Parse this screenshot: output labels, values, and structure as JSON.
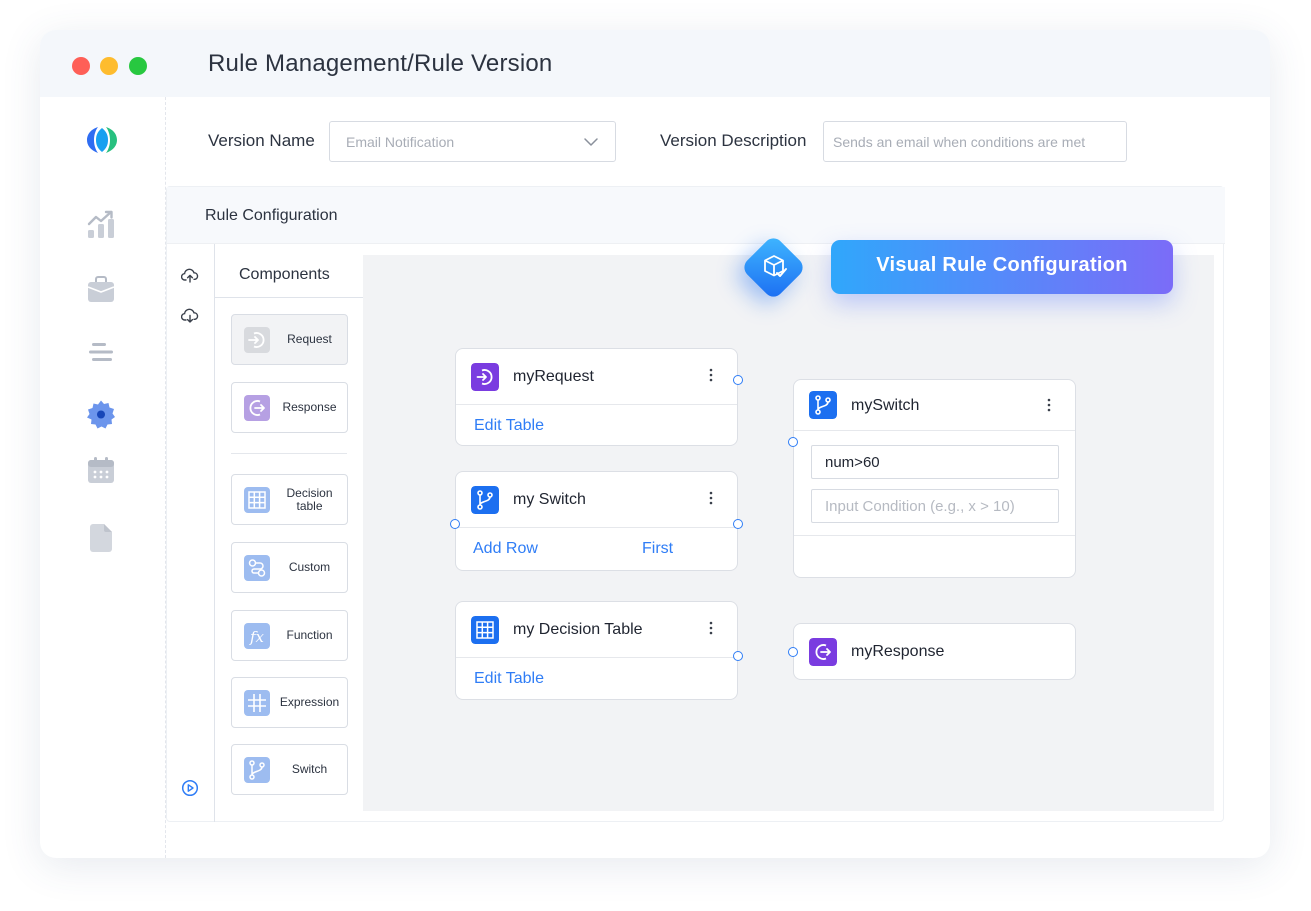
{
  "window": {
    "title": "Rule Management/Rule Version"
  },
  "form": {
    "version_name_label": "Version Name",
    "version_name_placeholder": "Email Notification",
    "version_desc_label": "Version Description",
    "version_desc_placeholder": "Sends an email when conditions are met"
  },
  "config": {
    "title": "Rule Configuration"
  },
  "components": {
    "title": "Components",
    "items": [
      {
        "label": "Request",
        "icon": "request-icon"
      },
      {
        "label": "Response",
        "icon": "response-icon"
      },
      {
        "label": "Decision table",
        "icon": "table-icon"
      },
      {
        "label": "Custom",
        "icon": "custom-icon"
      },
      {
        "label": "Function",
        "icon": "function-icon"
      },
      {
        "label": "Expression",
        "icon": "expression-icon"
      },
      {
        "label": "Switch",
        "icon": "switch-icon"
      }
    ]
  },
  "badge": {
    "label": "Visual Rule Configuration"
  },
  "nodes": {
    "request": {
      "title": "myRequest",
      "action": "Edit Table"
    },
    "switch": {
      "title": "my Switch",
      "action1": "Add Row",
      "action2": "First"
    },
    "decision": {
      "title": "my Decision Table",
      "action": "Edit Table"
    },
    "switch2": {
      "title": "mySwitch",
      "cond1": "num>60",
      "cond2_placeholder": "Input Condition (e.g., x > 10)"
    },
    "response": {
      "title": "myResponse"
    }
  },
  "colors": {
    "accent": "#2f7df6",
    "purple": "#7a3ce0",
    "blue": "#1c6ff0"
  }
}
